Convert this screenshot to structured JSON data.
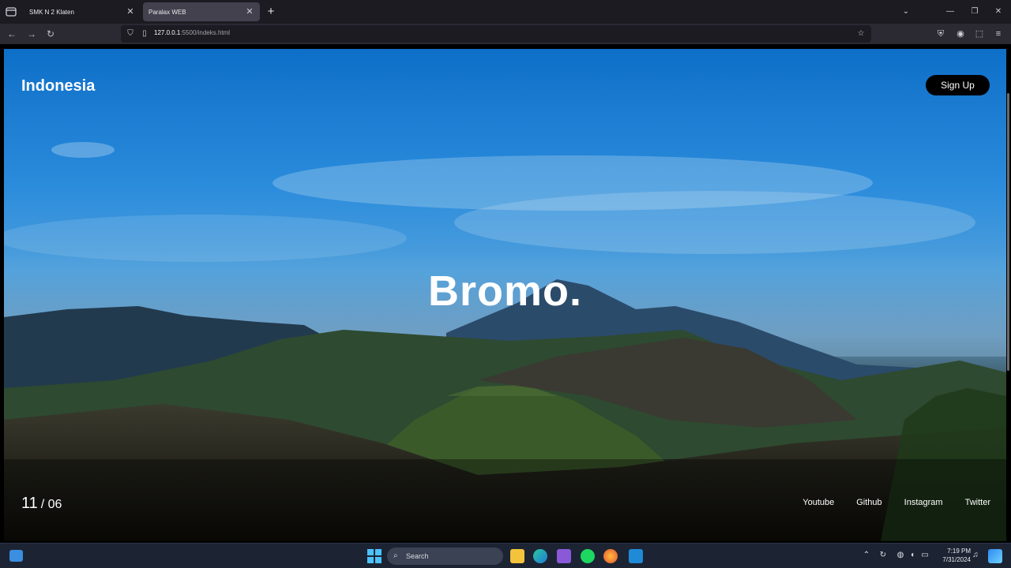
{
  "browser": {
    "tabs": [
      {
        "title": "SMK N 2 Klaten",
        "active": false
      },
      {
        "title": "Paralax WEB",
        "active": true
      }
    ],
    "url": {
      "host": "127.0.0.1",
      "rest": ":5500/indeks.html"
    }
  },
  "page": {
    "brand": "Indonesia",
    "signup_label": "Sign Up",
    "hero_title": "Bromo.",
    "counter_current": "11",
    "counter_total": "/ 06",
    "social_links": [
      "Youtube",
      "Github",
      "Instagram",
      "Twitter"
    ]
  },
  "taskbar": {
    "search_placeholder": "Search",
    "time": "7:19 PM",
    "date": "7/31/2024"
  },
  "colors": {
    "sky_top": "#0e6fc8",
    "button_bg": "#000000",
    "taskbar_bg": "#1c2433"
  }
}
